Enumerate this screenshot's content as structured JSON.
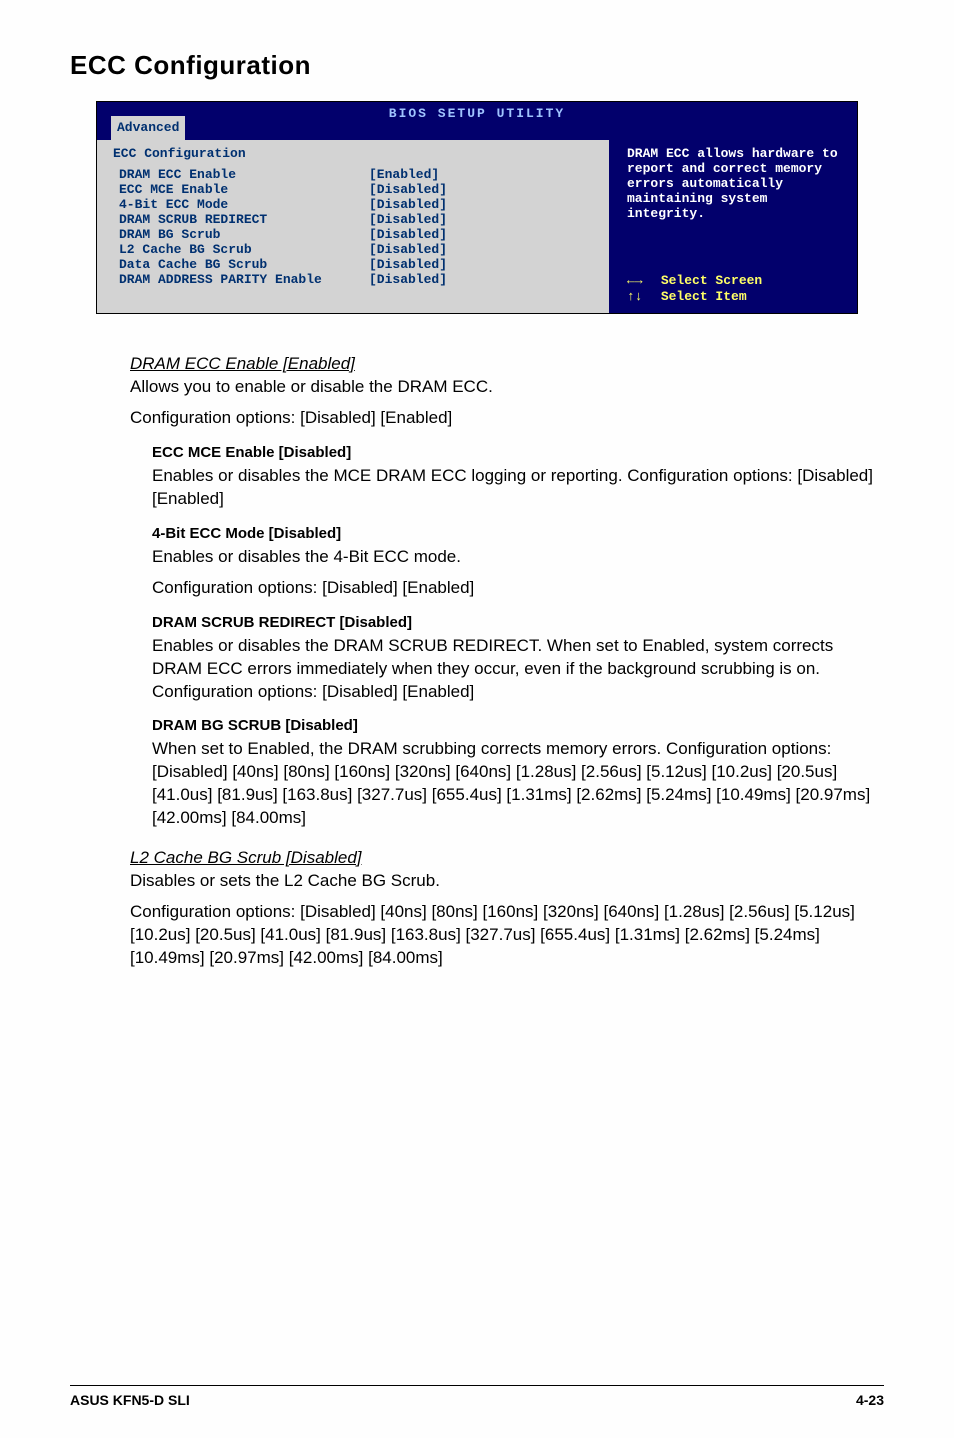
{
  "page": {
    "section_title": "ECC Configuration",
    "footer_left": "ASUS KFN5-D SLI",
    "footer_right": "4-23"
  },
  "bios": {
    "header_title": "BIOS SETUP UTILITY",
    "tab": "Advanced",
    "panel_heading": "ECC Configuration",
    "rows": [
      {
        "label": "DRAM ECC Enable",
        "value": "[Enabled]"
      },
      {
        "label": " ECC MCE Enable",
        "value": "[Disabled]"
      },
      {
        "label": " 4-Bit ECC Mode",
        "value": "[Disabled]"
      },
      {
        "label": " DRAM SCRUB REDIRECT",
        "value": "[Disabled]"
      },
      {
        "label": " DRAM BG Scrub",
        "value": "[Disabled]"
      },
      {
        "label": "L2 Cache BG Scrub",
        "value": "[Disabled]"
      },
      {
        "label": "Data Cache BG Scrub",
        "value": "[Disabled]"
      },
      {
        "label": "DRAM ADDRESS PARITY Enable",
        "value": "[Disabled]"
      }
    ],
    "help_text": "DRAM ECC allows hardware to report and correct memory errors automatically maintaining system integrity.",
    "nav1_arrow": "←→",
    "nav1_text": "Select Screen",
    "nav2_arrow": "↑↓",
    "nav2_text": "Select Item"
  },
  "options": {
    "dram_ecc_enable": {
      "title": "DRAM ECC Enable [Enabled]",
      "desc1": "Allows you to enable or disable the DRAM ECC.",
      "desc2": "Configuration options: [Disabled] [Enabled]"
    },
    "ecc_mce": {
      "title": "ECC MCE Enable [Disabled]",
      "desc": "Enables or disables the MCE DRAM ECC logging or reporting. Configuration options: [Disabled] [Enabled]"
    },
    "four_bit": {
      "title": "4-Bit ECC Mode [Disabled]",
      "desc1": "Enables or disables the 4-Bit ECC mode.",
      "desc2": "Configuration options: [Disabled] [Enabled]"
    },
    "scrub_redirect": {
      "title": "DRAM SCRUB REDIRECT [Disabled]",
      "desc": "Enables or disables the DRAM SCRUB REDIRECT. When set to Enabled, system corrects DRAM ECC errors immediately when they occur, even if the background scrubbing is on. Configuration options: [Disabled] [Enabled]"
    },
    "bg_scrub": {
      "title": "DRAM BG SCRUB [Disabled]",
      "desc": "When set to Enabled, the DRAM scrubbing corrects memory errors. Configuration options: [Disabled] [40ns] [80ns] [160ns] [320ns] [640ns] [1.28us] [2.56us] [5.12us] [10.2us] [20.5us] [41.0us] [81.9us] [163.8us] [327.7us] [655.4us] [1.31ms] [2.62ms] [5.24ms] [10.49ms] [20.97ms] [42.00ms] [84.00ms]"
    },
    "l2_cache": {
      "title": "L2 Cache BG Scrub [Disabled]",
      "desc1": "Disables or sets the L2 Cache BG Scrub.",
      "desc2": "Configuration options: [Disabled] [40ns] [80ns] [160ns] [320ns] [640ns] [1.28us] [2.56us] [5.12us] [10.2us] [20.5us] [41.0us] [81.9us] [163.8us] [327.7us] [655.4us] [1.31ms] [2.62ms] [5.24ms] [10.49ms] [20.97ms] [42.00ms] [84.00ms]"
    }
  }
}
